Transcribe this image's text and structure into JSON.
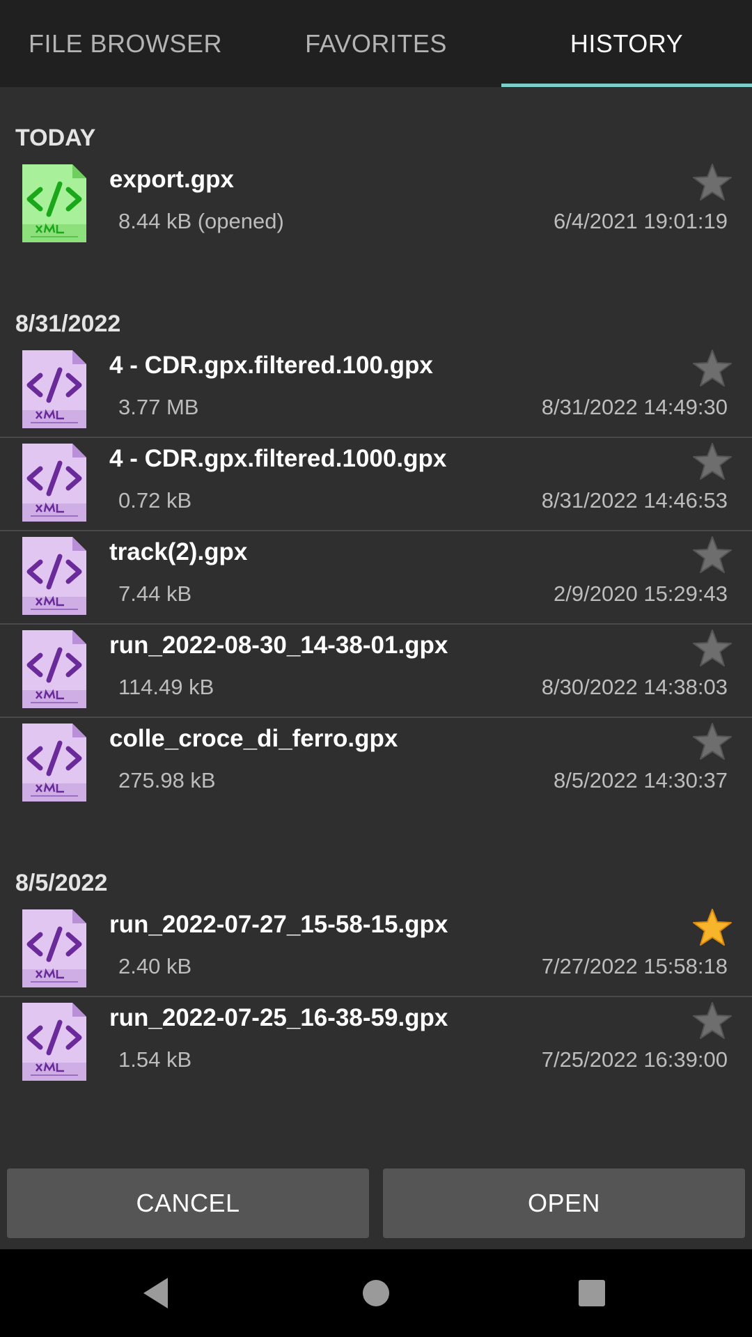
{
  "tabs": [
    {
      "label": "FILE BROWSER",
      "active": false
    },
    {
      "label": "FAVORITES",
      "active": false
    },
    {
      "label": "HISTORY",
      "active": true
    }
  ],
  "sections": [
    {
      "header": "TODAY",
      "items": [
        {
          "name": "export.gpx",
          "size": "8.44 kB (opened)",
          "date": "6/4/2021 19:01:19",
          "icon": "xml-file-green-icon",
          "favorite": false
        }
      ]
    },
    {
      "header": "8/31/2022",
      "items": [
        {
          "name": "4 - CDR.gpx.filtered.100.gpx",
          "size": "3.77 MB",
          "date": "8/31/2022 14:49:30",
          "icon": "xml-file-purple-icon",
          "favorite": false
        },
        {
          "name": "4 - CDR.gpx.filtered.1000.gpx",
          "size": "0.72 kB",
          "date": "8/31/2022 14:46:53",
          "icon": "xml-file-purple-icon",
          "favorite": false
        },
        {
          "name": "track(2).gpx",
          "size": "7.44 kB",
          "date": "2/9/2020 15:29:43",
          "icon": "xml-file-purple-icon",
          "favorite": false
        },
        {
          "name": "run_2022-08-30_14-38-01.gpx",
          "size": "114.49 kB",
          "date": "8/30/2022 14:38:03",
          "icon": "xml-file-purple-icon",
          "favorite": false
        },
        {
          "name": "colle_croce_di_ferro.gpx",
          "size": "275.98 kB",
          "date": "8/5/2022 14:30:37",
          "icon": "xml-file-purple-icon",
          "favorite": false
        }
      ]
    },
    {
      "header": "8/5/2022",
      "items": [
        {
          "name": "run_2022-07-27_15-58-15.gpx",
          "size": "2.40 kB",
          "date": "7/27/2022 15:58:18",
          "icon": "xml-file-purple-icon",
          "favorite": true
        },
        {
          "name": "run_2022-07-25_16-38-59.gpx",
          "size": "1.54 kB",
          "date": "7/25/2022 16:39:00",
          "icon": "xml-file-purple-icon",
          "favorite": false
        }
      ]
    }
  ],
  "buttons": {
    "cancel": "CANCEL",
    "open": "OPEN"
  },
  "colors": {
    "accent": "#7ecfc7",
    "star_off": "#6e6e6e",
    "star_on": "#f7b52c",
    "background": "#2f2f2f",
    "tabbar": "#202020",
    "button": "#555555"
  }
}
